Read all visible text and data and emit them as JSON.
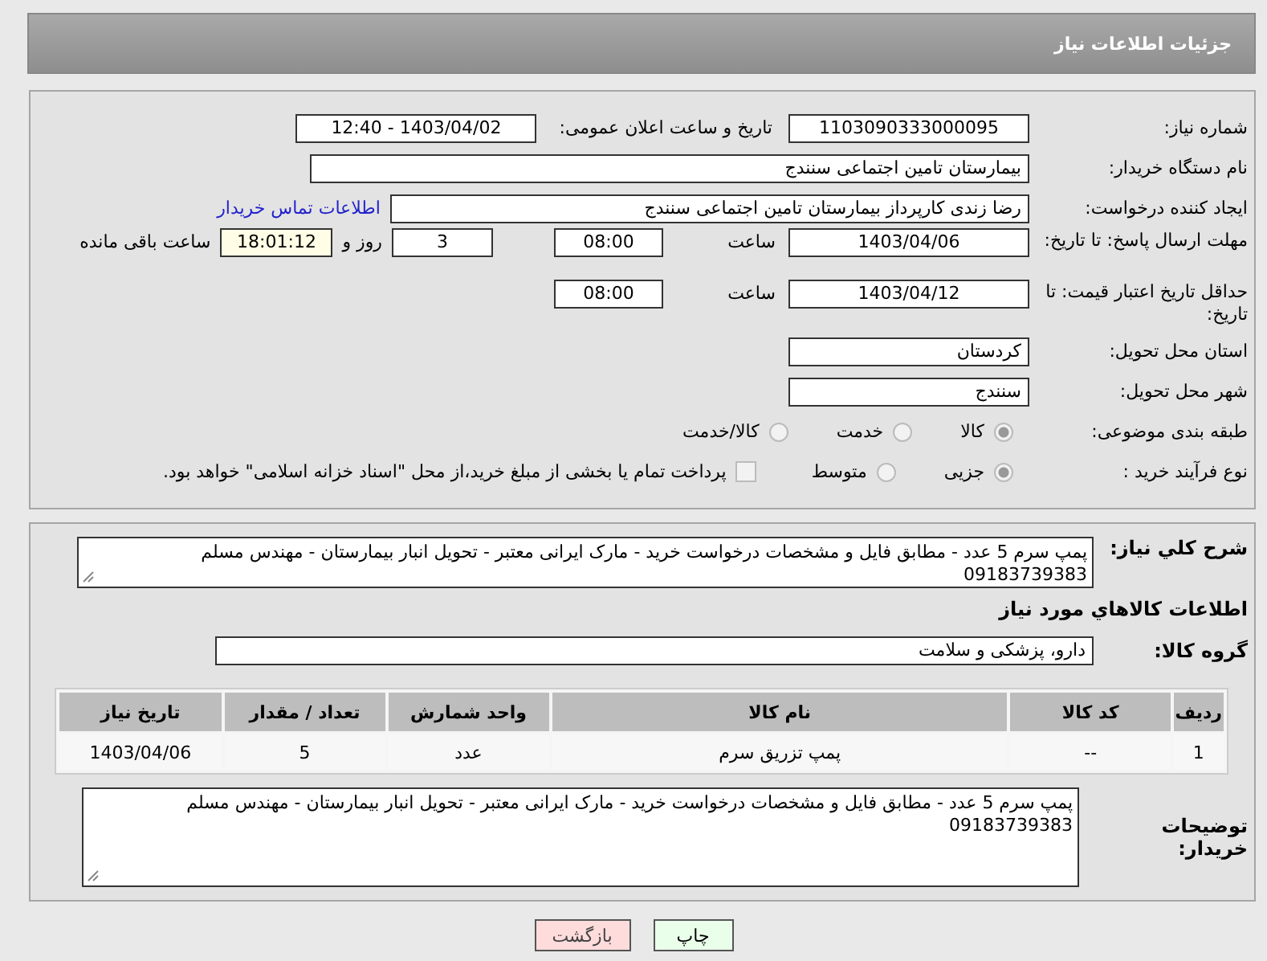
{
  "page_title": "جزئیات اطلاعات نیاز",
  "need_number": {
    "label": "شماره نیاز:",
    "value": "1103090333000095"
  },
  "announce": {
    "label": "تاریخ و ساعت اعلان عمومی:",
    "value": "1403/04/02 - 12:40"
  },
  "buyer_org": {
    "label": "نام دستگاه خریدار:",
    "value": "بیمارستان تامین اجتماعی سنندج"
  },
  "requester": {
    "label": "ایجاد کننده درخواست:",
    "value": "رضا زندی کارپرداز بیمارستان تامین اجتماعی سنندج",
    "link": "اطلاعات تماس خریدار"
  },
  "response_deadline": {
    "label": "مهلت ارسال پاسخ: تا تاریخ:",
    "date": "1403/04/06",
    "time_label": "ساعت",
    "time": "08:00",
    "days": "3",
    "days_label": "روز و",
    "remaining": "18:01:12",
    "remaining_label": "ساعت باقی مانده"
  },
  "price_validity": {
    "label": "حداقل تاریخ اعتبار قیمت: تا تاریخ:",
    "date": "1403/04/12",
    "time_label": "ساعت",
    "time": "08:00"
  },
  "province": {
    "label": "استان محل تحویل:",
    "value": "کردستان"
  },
  "city": {
    "label": "شهر محل تحویل:",
    "value": "سنندج"
  },
  "category": {
    "label": "طبقه بندی موضوعی:",
    "options": [
      {
        "label": "کالا",
        "selected": true
      },
      {
        "label": "خدمت",
        "selected": false
      },
      {
        "label": "کالا/خدمت",
        "selected": false
      }
    ]
  },
  "purchase_process": {
    "label": "نوع فرآیند خرید :",
    "options": [
      {
        "label": "جزیی",
        "selected": true
      },
      {
        "label": "متوسط",
        "selected": false
      }
    ],
    "treasury": {
      "label": "پرداخت تمام یا بخشی از مبلغ خرید،از محل \"اسناد خزانه اسلامی\" خواهد بود.",
      "checked": false
    }
  },
  "description": {
    "label": "شرح كلي نياز:",
    "value": "پمپ سرم 5  عدد - مطابق فایل و مشخصات درخواست خرید - مارک ایرانی معتبر - تحویل انبار بیمارستان - مهندس مسلم 09183739383"
  },
  "goods_heading": "اطلاعات كالاهاي مورد نياز",
  "goods_group": {
    "label": "گروه کالا:",
    "value": "دارو، پزشکی و سلامت"
  },
  "table": {
    "columns": [
      "ردیف",
      "کد کالا",
      "نام کالا",
      "واحد شمارش",
      "تعداد / مقدار",
      "تاریخ نیاز"
    ],
    "rows": [
      [
        "1",
        "--",
        "پمپ تزریق سرم",
        "عدد",
        "5",
        "1403/04/06"
      ]
    ]
  },
  "buyer_notes": {
    "label": "توضیحات خریدار:",
    "value": "پمپ سرم 5 عدد -   مطابق فایل و مشخصات درخواست خرید - مارک ایرانی معتبر - تحویل انبار بیمارستان - مهندس مسلم 09183739383"
  },
  "buttons": [
    {
      "label": "چاپ",
      "kind": "print"
    },
    {
      "label": "بازگشت",
      "kind": "back"
    }
  ]
}
